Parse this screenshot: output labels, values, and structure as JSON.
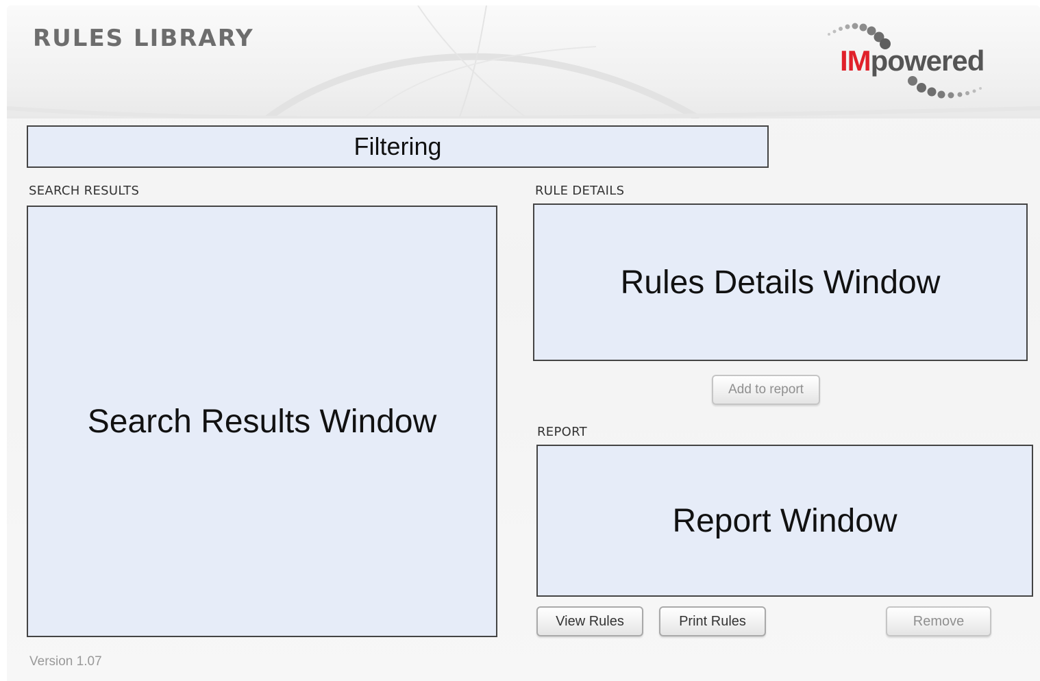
{
  "app": {
    "title": "RULES LIBRARY",
    "version": "Version 1.07"
  },
  "logo": {
    "prefix": "IM",
    "suffix": "powered",
    "prefix_color": "#e0202a",
    "suffix_color": "#555555"
  },
  "filter": {
    "label": "Filtering"
  },
  "search_results": {
    "section_label": "SEARCH RESULTS",
    "placeholder": "Search Results Window"
  },
  "rule_details": {
    "section_label": "RULE DETAILS",
    "placeholder": "Rules Details Window",
    "add_button": "Add to report"
  },
  "report": {
    "section_label": "REPORT",
    "placeholder": "Report Window",
    "view_button": "View Rules",
    "print_button": "Print Rules",
    "remove_button": "Remove"
  },
  "colors": {
    "panel_fill": "#e6ecf8",
    "panel_border": "#444444",
    "title_gray": "#6d6d6d"
  }
}
